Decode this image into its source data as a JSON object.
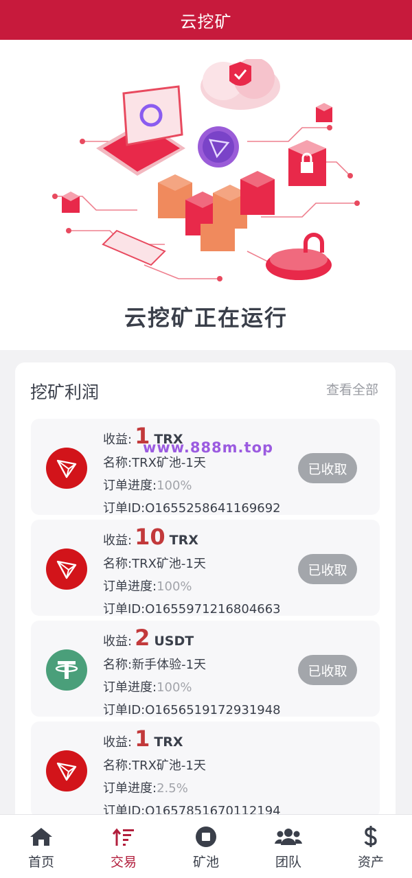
{
  "header": {
    "title": "云挖矿"
  },
  "hero": {
    "status_text": "云挖矿正在运行"
  },
  "profits": {
    "title": "挖矿利润",
    "view_all": "查看全部",
    "income_label": "收益:",
    "name_label": "名称:",
    "progress_label": "订单进度:",
    "order_label": "订单ID:",
    "items": [
      {
        "coin": "TRX",
        "icon": "tron-icon",
        "amount": "1",
        "unit": "TRX",
        "name": "TRX矿池-1天",
        "progress": "100%",
        "order_id": "O1655258641169692",
        "status": "已收取"
      },
      {
        "coin": "TRX",
        "icon": "tron-icon",
        "amount": "10",
        "unit": "TRX",
        "name": "TRX矿池-1天",
        "progress": "100%",
        "order_id": "O1655971216804663",
        "status": "已收取"
      },
      {
        "coin": "USDT",
        "icon": "tether-icon",
        "amount": "2",
        "unit": "USDT",
        "name": "新手体验-1天",
        "progress": "100%",
        "order_id": "O1656519172931948",
        "status": "已收取"
      },
      {
        "coin": "TRX",
        "icon": "tron-icon",
        "amount": "1",
        "unit": "TRX",
        "name": "TRX矿池-1天",
        "progress": "2.5%",
        "order_id": "O1657851670112194",
        "status": ""
      }
    ]
  },
  "watermark": "www.888m.top",
  "tabbar": {
    "items": [
      {
        "label": "首页",
        "icon": "home-icon",
        "active": false
      },
      {
        "label": "交易",
        "icon": "sort-icon",
        "active": true
      },
      {
        "label": "矿池",
        "icon": "stop-circle-icon",
        "active": false
      },
      {
        "label": "团队",
        "icon": "users-icon",
        "active": false
      },
      {
        "label": "资产",
        "icon": "dollar-icon",
        "active": false
      }
    ]
  },
  "colors": {
    "brand": "#c71a3c",
    "amount": "#c2393b",
    "trx": "#d2141a",
    "usdt": "#4a9f7a",
    "button": "#a3a6ab"
  }
}
